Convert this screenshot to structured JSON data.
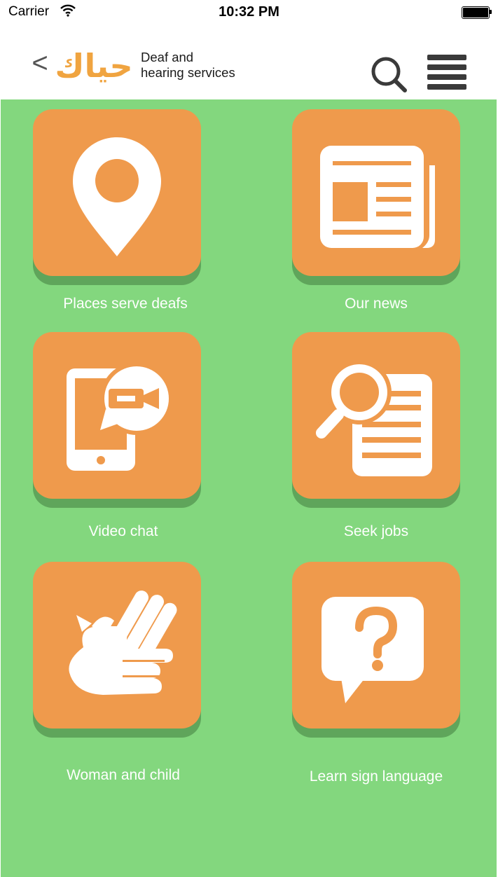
{
  "status_bar": {
    "carrier": "Carrier",
    "time": "10:32 PM"
  },
  "header": {
    "back_label": "<",
    "logo_text": "حياك",
    "subtitle_line1": "Deaf and",
    "subtitle_line2": "hearing services",
    "search_icon": "search-icon",
    "menu_icon": "hamburger-menu-icon"
  },
  "colors": {
    "background": "#83d77e",
    "tile": "#ef9a4c",
    "tile_shadow": "#5fa55b",
    "label": "#ffffff"
  },
  "tiles": [
    {
      "label": "Places serve deafs",
      "icon": "location-pin-icon"
    },
    {
      "label": "Our news",
      "icon": "newspaper-icon"
    },
    {
      "label": "Video chat",
      "icon": "video-chat-phone-icon"
    },
    {
      "label": "Seek jobs",
      "icon": "job-search-icon"
    },
    {
      "label": "Woman and child",
      "icon": "clapping-hands-icon"
    },
    {
      "label": "Learn sign language",
      "icon": "question-bubble-icon"
    }
  ]
}
